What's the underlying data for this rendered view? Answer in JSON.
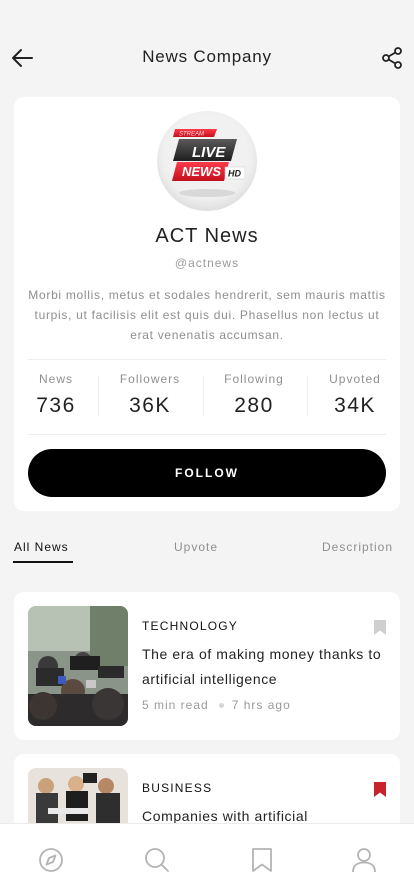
{
  "header": {
    "title": "News Company"
  },
  "profile": {
    "logo_texts": [
      "STREAM",
      "LIVE",
      "NEWS",
      "HD"
    ],
    "name": "ACT News",
    "handle": "@actnews",
    "bio": "Morbi mollis, metus et sodales hendrerit, sem mauris mattis turpis, ut facilisis elit est quis dui. Phasellus non lectus ut erat venenatis accumsan.",
    "stats": [
      {
        "label": "News",
        "value": "736"
      },
      {
        "label": "Followers",
        "value": "36K"
      },
      {
        "label": "Following",
        "value": "280"
      },
      {
        "label": "Upvoted",
        "value": "34K"
      }
    ],
    "follow_label": "FOLLOW"
  },
  "tabs": [
    {
      "label": "All News",
      "active": true
    },
    {
      "label": "Upvote",
      "active": false
    },
    {
      "label": "Description",
      "active": false
    }
  ],
  "news": [
    {
      "category": "TECHNOLOGY",
      "headline": "The era of making money thanks to artificial intelligence",
      "read_time": "5 min read",
      "posted": "7 hrs ago",
      "bookmarked": false
    },
    {
      "category": "BUSINESS",
      "headline": "Companies with artificial",
      "bookmarked": true
    }
  ],
  "colors": {
    "accent": "#000000",
    "bookmark_active": "#c8232c",
    "bookmark_inactive": "#cfcfcf",
    "background": "#f4f4f5"
  },
  "bottom_nav": [
    "compass-icon",
    "search-icon",
    "bookmark-icon",
    "profile-icon"
  ]
}
